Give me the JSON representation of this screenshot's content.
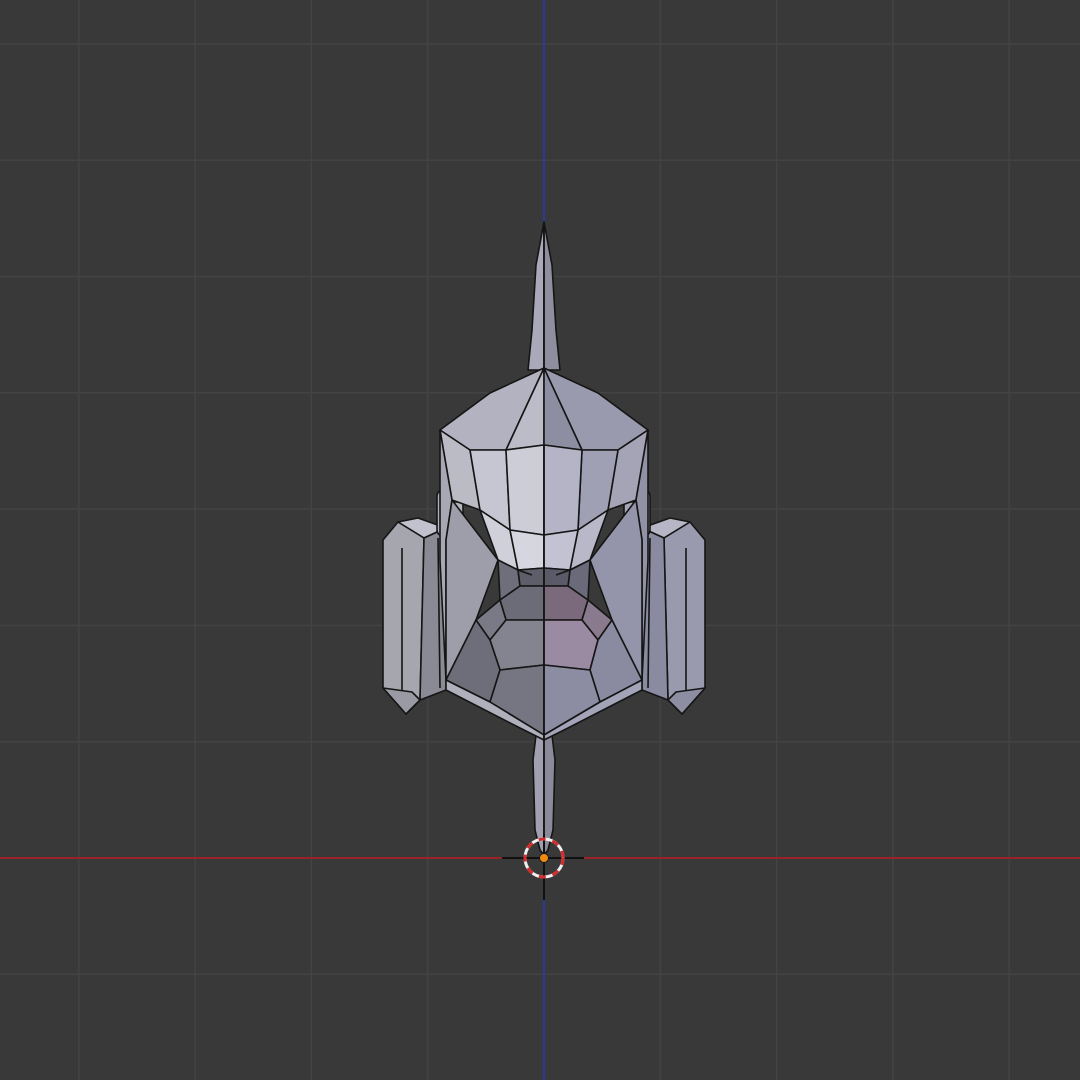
{
  "viewport": {
    "colors": {
      "background": "#393939",
      "grid_line": "#434343",
      "x_axis": "#9b2226",
      "z_axis": "#2a3a9c",
      "mesh_face_light": "#b8b8c8",
      "mesh_face_mid": "#9a9aaa",
      "mesh_face_dark": "#767684",
      "mesh_edge": "#151515",
      "origin_dot": "#f08a10",
      "cursor_ring_red": "#d42a2a",
      "cursor_ring_white": "#f0f0f0"
    },
    "icons": {
      "cursor": "3d-cursor-icon",
      "origin": "object-origin-icon"
    }
  }
}
